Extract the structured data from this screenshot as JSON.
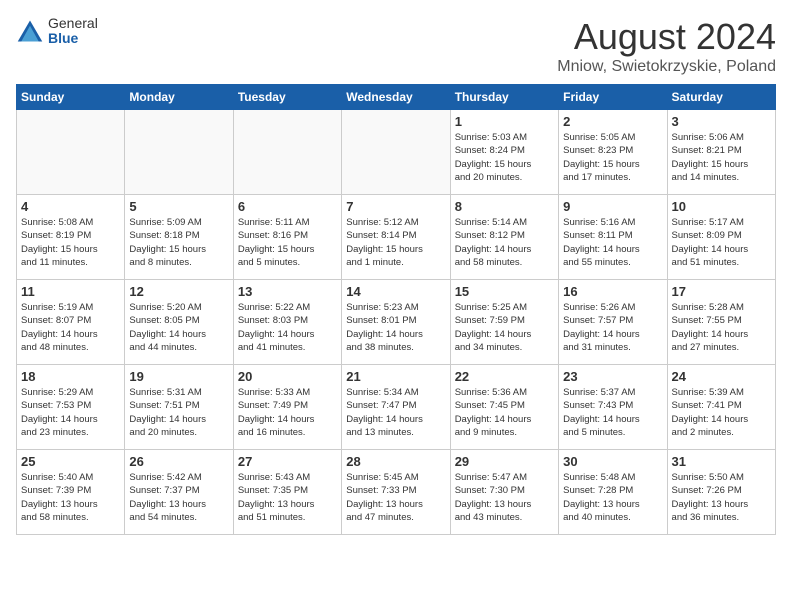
{
  "logo": {
    "general": "General",
    "blue": "Blue"
  },
  "header": {
    "month": "August 2024",
    "location": "Mniow, Swietokrzyskie, Poland"
  },
  "weekdays": [
    "Sunday",
    "Monday",
    "Tuesday",
    "Wednesday",
    "Thursday",
    "Friday",
    "Saturday"
  ],
  "weeks": [
    [
      {
        "day": "",
        "info": ""
      },
      {
        "day": "",
        "info": ""
      },
      {
        "day": "",
        "info": ""
      },
      {
        "day": "",
        "info": ""
      },
      {
        "day": "1",
        "info": "Sunrise: 5:03 AM\nSunset: 8:24 PM\nDaylight: 15 hours\nand 20 minutes."
      },
      {
        "day": "2",
        "info": "Sunrise: 5:05 AM\nSunset: 8:23 PM\nDaylight: 15 hours\nand 17 minutes."
      },
      {
        "day": "3",
        "info": "Sunrise: 5:06 AM\nSunset: 8:21 PM\nDaylight: 15 hours\nand 14 minutes."
      }
    ],
    [
      {
        "day": "4",
        "info": "Sunrise: 5:08 AM\nSunset: 8:19 PM\nDaylight: 15 hours\nand 11 minutes."
      },
      {
        "day": "5",
        "info": "Sunrise: 5:09 AM\nSunset: 8:18 PM\nDaylight: 15 hours\nand 8 minutes."
      },
      {
        "day": "6",
        "info": "Sunrise: 5:11 AM\nSunset: 8:16 PM\nDaylight: 15 hours\nand 5 minutes."
      },
      {
        "day": "7",
        "info": "Sunrise: 5:12 AM\nSunset: 8:14 PM\nDaylight: 15 hours\nand 1 minute."
      },
      {
        "day": "8",
        "info": "Sunrise: 5:14 AM\nSunset: 8:12 PM\nDaylight: 14 hours\nand 58 minutes."
      },
      {
        "day": "9",
        "info": "Sunrise: 5:16 AM\nSunset: 8:11 PM\nDaylight: 14 hours\nand 55 minutes."
      },
      {
        "day": "10",
        "info": "Sunrise: 5:17 AM\nSunset: 8:09 PM\nDaylight: 14 hours\nand 51 minutes."
      }
    ],
    [
      {
        "day": "11",
        "info": "Sunrise: 5:19 AM\nSunset: 8:07 PM\nDaylight: 14 hours\nand 48 minutes."
      },
      {
        "day": "12",
        "info": "Sunrise: 5:20 AM\nSunset: 8:05 PM\nDaylight: 14 hours\nand 44 minutes."
      },
      {
        "day": "13",
        "info": "Sunrise: 5:22 AM\nSunset: 8:03 PM\nDaylight: 14 hours\nand 41 minutes."
      },
      {
        "day": "14",
        "info": "Sunrise: 5:23 AM\nSunset: 8:01 PM\nDaylight: 14 hours\nand 38 minutes."
      },
      {
        "day": "15",
        "info": "Sunrise: 5:25 AM\nSunset: 7:59 PM\nDaylight: 14 hours\nand 34 minutes."
      },
      {
        "day": "16",
        "info": "Sunrise: 5:26 AM\nSunset: 7:57 PM\nDaylight: 14 hours\nand 31 minutes."
      },
      {
        "day": "17",
        "info": "Sunrise: 5:28 AM\nSunset: 7:55 PM\nDaylight: 14 hours\nand 27 minutes."
      }
    ],
    [
      {
        "day": "18",
        "info": "Sunrise: 5:29 AM\nSunset: 7:53 PM\nDaylight: 14 hours\nand 23 minutes."
      },
      {
        "day": "19",
        "info": "Sunrise: 5:31 AM\nSunset: 7:51 PM\nDaylight: 14 hours\nand 20 minutes."
      },
      {
        "day": "20",
        "info": "Sunrise: 5:33 AM\nSunset: 7:49 PM\nDaylight: 14 hours\nand 16 minutes."
      },
      {
        "day": "21",
        "info": "Sunrise: 5:34 AM\nSunset: 7:47 PM\nDaylight: 14 hours\nand 13 minutes."
      },
      {
        "day": "22",
        "info": "Sunrise: 5:36 AM\nSunset: 7:45 PM\nDaylight: 14 hours\nand 9 minutes."
      },
      {
        "day": "23",
        "info": "Sunrise: 5:37 AM\nSunset: 7:43 PM\nDaylight: 14 hours\nand 5 minutes."
      },
      {
        "day": "24",
        "info": "Sunrise: 5:39 AM\nSunset: 7:41 PM\nDaylight: 14 hours\nand 2 minutes."
      }
    ],
    [
      {
        "day": "25",
        "info": "Sunrise: 5:40 AM\nSunset: 7:39 PM\nDaylight: 13 hours\nand 58 minutes."
      },
      {
        "day": "26",
        "info": "Sunrise: 5:42 AM\nSunset: 7:37 PM\nDaylight: 13 hours\nand 54 minutes."
      },
      {
        "day": "27",
        "info": "Sunrise: 5:43 AM\nSunset: 7:35 PM\nDaylight: 13 hours\nand 51 minutes."
      },
      {
        "day": "28",
        "info": "Sunrise: 5:45 AM\nSunset: 7:33 PM\nDaylight: 13 hours\nand 47 minutes."
      },
      {
        "day": "29",
        "info": "Sunrise: 5:47 AM\nSunset: 7:30 PM\nDaylight: 13 hours\nand 43 minutes."
      },
      {
        "day": "30",
        "info": "Sunrise: 5:48 AM\nSunset: 7:28 PM\nDaylight: 13 hours\nand 40 minutes."
      },
      {
        "day": "31",
        "info": "Sunrise: 5:50 AM\nSunset: 7:26 PM\nDaylight: 13 hours\nand 36 minutes."
      }
    ]
  ]
}
